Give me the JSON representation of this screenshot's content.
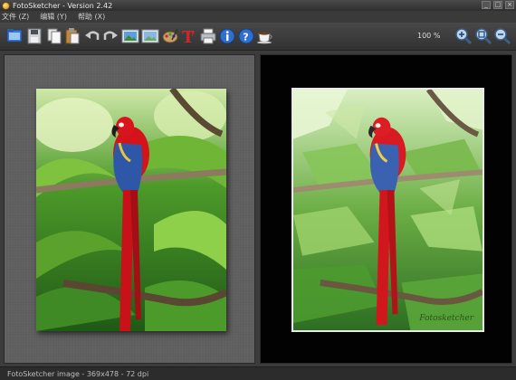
{
  "window": {
    "title": "FotoSketcher - Version 2.42",
    "buttons": {
      "minimize": "_",
      "maximize": "□",
      "close": "×"
    }
  },
  "menu": {
    "items": [
      {
        "label": "文件 (Z)"
      },
      {
        "label": "编辑 (Y)"
      },
      {
        "label": "帮助 (X)"
      }
    ]
  },
  "toolbar": {
    "zoom": "100 %",
    "icons": [
      "open-icon",
      "save-icon",
      "copy-icon",
      "paste-icon",
      "undo-icon",
      "redo-icon",
      "image-original-icon",
      "image-result-icon",
      "palette-icon",
      "text-icon",
      "print-icon",
      "info-icon",
      "help-icon",
      "coffee-cup-icon",
      "zoom-in-icon",
      "zoom-fit-icon",
      "zoom-out-icon"
    ]
  },
  "canvas": {
    "sketch_signature": "Fotosketcher"
  },
  "status": {
    "text": "FotoSketcher image - 369x478 - 72 dpi"
  },
  "colors": {
    "background": "#3c3c3c",
    "left_pane": "#5e5e5e",
    "right_pane": "#020202",
    "parrot_red": "#d4131a",
    "parrot_blue": "#2f57a8",
    "foliage_green": "#3e8a25"
  }
}
